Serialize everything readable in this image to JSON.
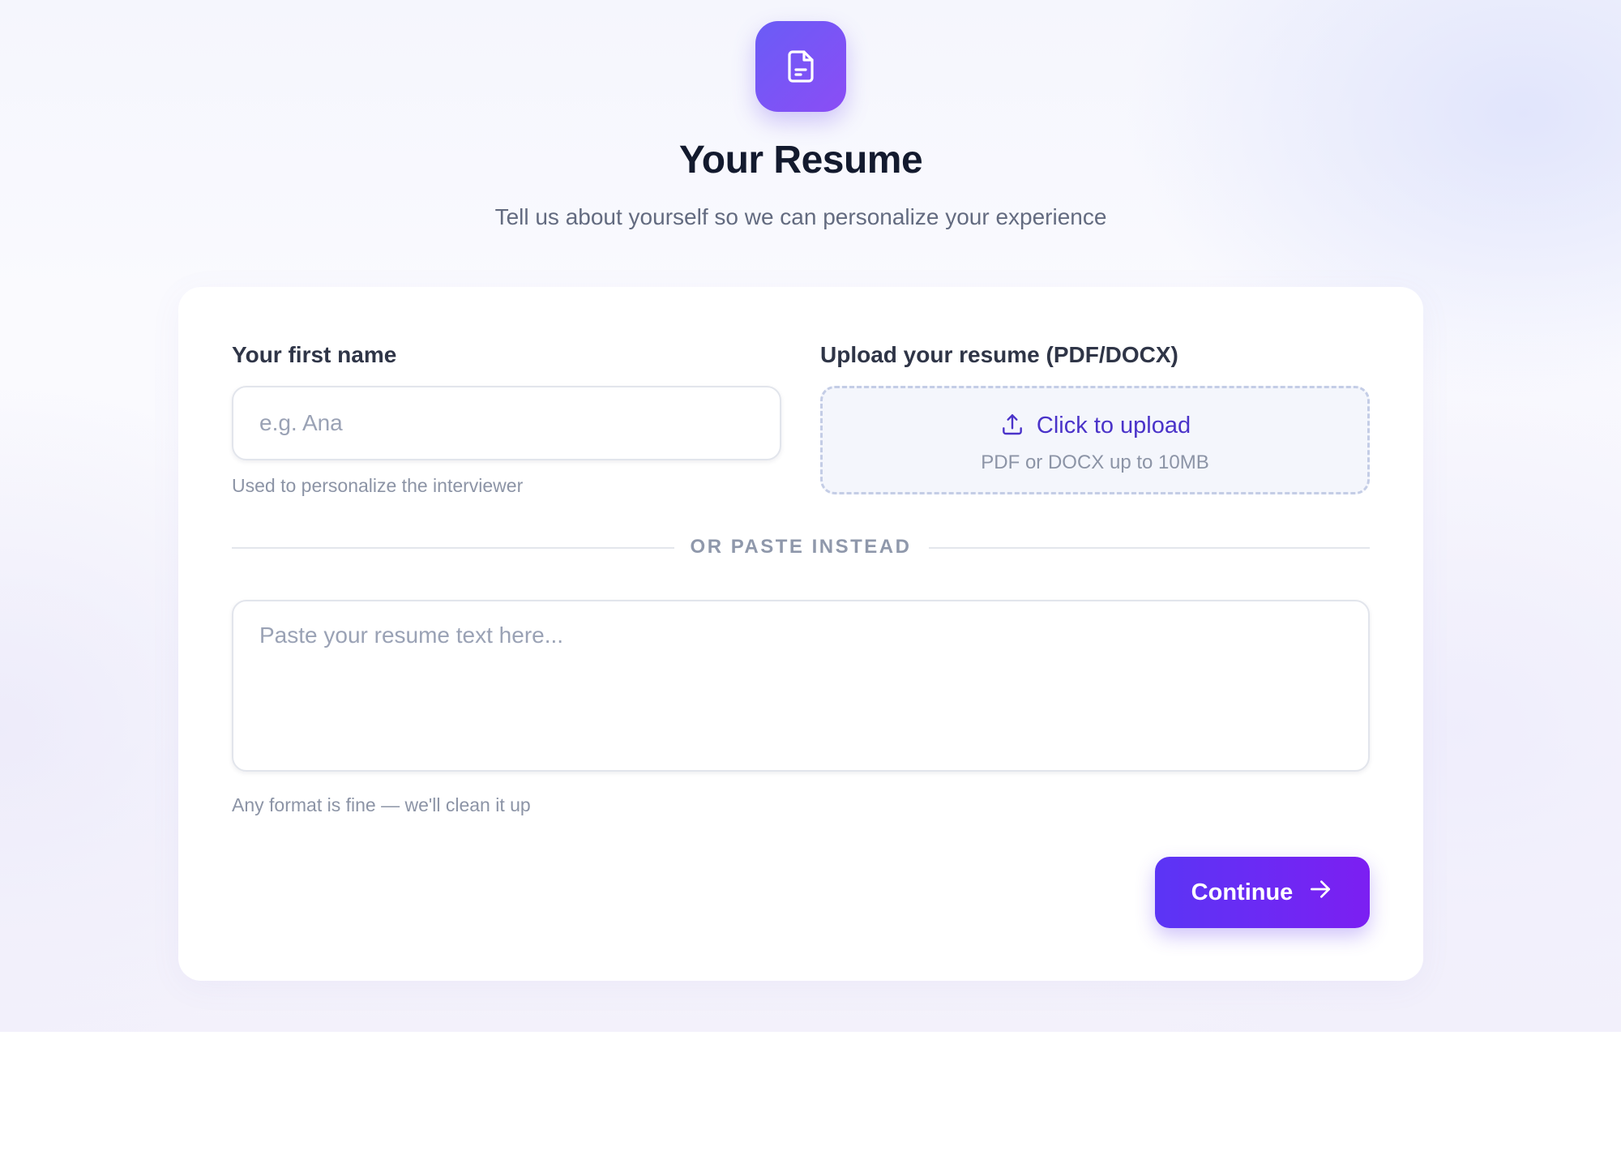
{
  "header": {
    "icon": "document-icon",
    "title": "Your Resume",
    "subtitle": "Tell us about yourself so we can personalize your experience"
  },
  "form": {
    "first_name": {
      "label": "Your first name",
      "value": "",
      "placeholder": "e.g. Ana",
      "helper": "Used to personalize the interviewer"
    },
    "upload": {
      "label": "Upload your resume (PDF/DOCX)",
      "icon": "upload-icon",
      "action_text": "Click to upload",
      "hint": "PDF or DOCX up to 10MB"
    },
    "divider_text": "OR PASTE INSTEAD",
    "resume_text": {
      "value": "",
      "placeholder": "Paste your resume text here...",
      "helper": "Any format is fine — we'll clean it up"
    },
    "continue_button": {
      "label": "Continue",
      "icon": "arrow-right-icon"
    }
  },
  "colors": {
    "accent_start": "#6a5cf6",
    "accent_end": "#8b4df5",
    "button_start": "#5b35f5",
    "button_end": "#7c1ff2",
    "upload_text": "#4a33c9",
    "title": "#131a2e"
  }
}
